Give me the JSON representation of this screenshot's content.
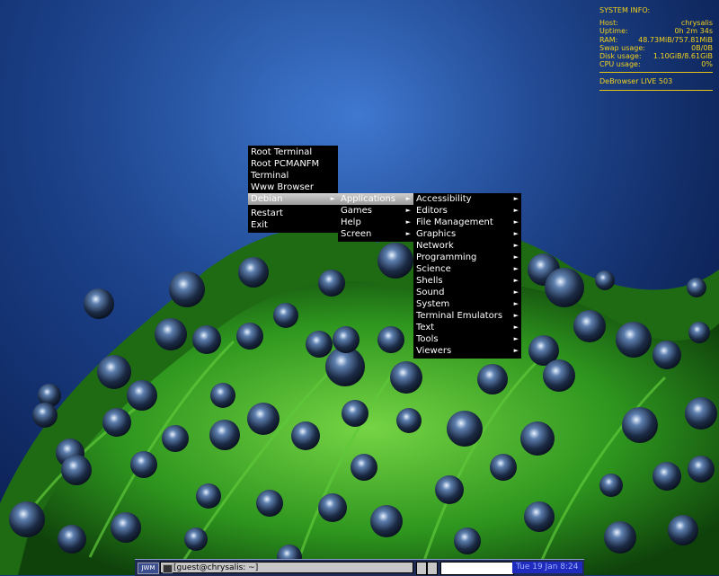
{
  "conky": {
    "header": "SYSTEM INFO:",
    "rows": [
      {
        "label": "Host:",
        "value": "chrysalis"
      },
      {
        "label": "Uptime:",
        "value": "0h 2m 34s"
      },
      {
        "label": "RAM:",
        "value": "48.73MiB/757.81MiB"
      },
      {
        "label": "Swap usage:",
        "value": "0B/0B"
      },
      {
        "label": "Disk usage:",
        "value": "1.10GiB/8.61GiB"
      },
      {
        "label": "CPU usage:",
        "value": "0%"
      }
    ],
    "footer": "DeBrowser LIVE 503",
    "color": "#f3d31c"
  },
  "root_menu": {
    "items": [
      "Root Terminal",
      "Root PCMANFM",
      "Terminal",
      "Www Browser",
      "Debian",
      "Restart",
      "Exit"
    ]
  },
  "debian_menu": {
    "items": [
      "Applications",
      "Games",
      "Help",
      "Screen"
    ]
  },
  "applications_menu": {
    "items": [
      "Accessibility",
      "Editors",
      "File Management",
      "Graphics",
      "Network",
      "Programming",
      "Science",
      "Shells",
      "Sound",
      "System",
      "Terminal Emulators",
      "Text",
      "Tools",
      "Viewers"
    ]
  },
  "taskbar": {
    "logo": "JWM",
    "task_title": "[guest@chrysalis: ~]",
    "clock": "Tue 19 Jan  8:24"
  }
}
